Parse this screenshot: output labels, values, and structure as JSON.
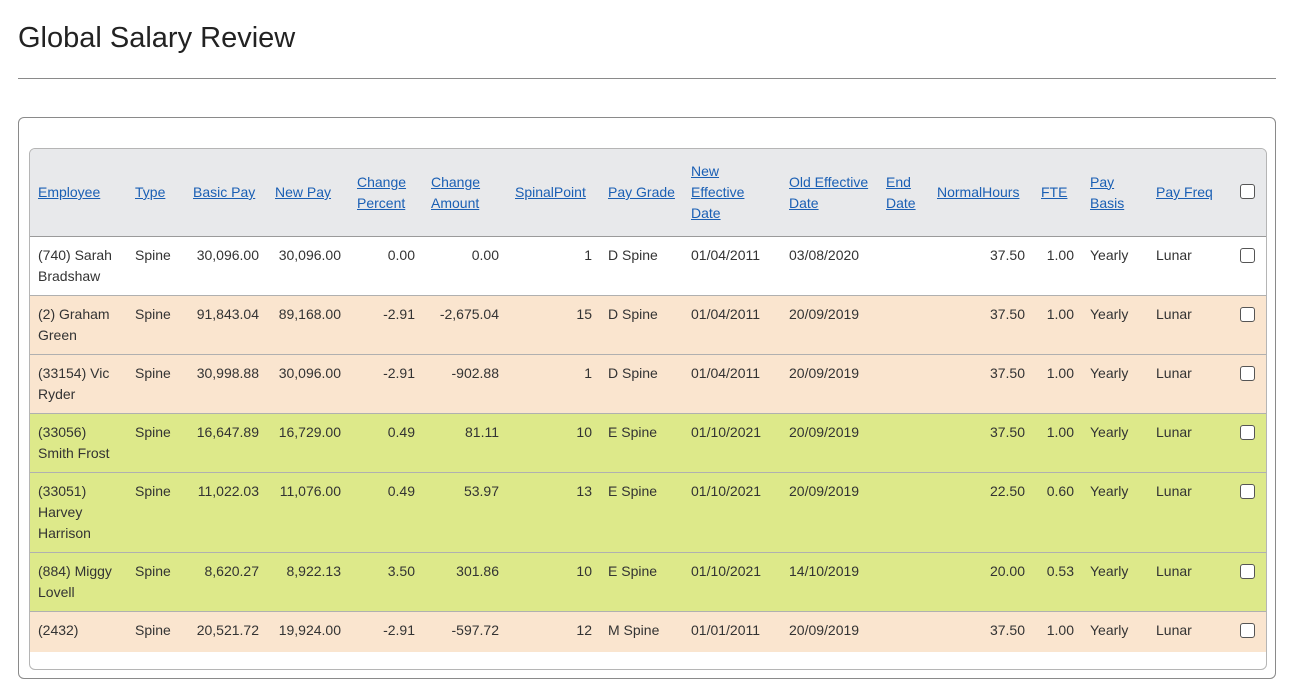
{
  "page": {
    "title": "Global Salary Review"
  },
  "table": {
    "columns": [
      {
        "key": "employee",
        "label": "Employee"
      },
      {
        "key": "type",
        "label": "Type"
      },
      {
        "key": "basic_pay",
        "label": "Basic Pay"
      },
      {
        "key": "new_pay",
        "label": "New Pay"
      },
      {
        "key": "change_percent",
        "label": "Change Percent"
      },
      {
        "key": "change_amount",
        "label": "Change Amount"
      },
      {
        "key": "spinal_point",
        "label": "SpinalPoint"
      },
      {
        "key": "pay_grade",
        "label": "Pay Grade"
      },
      {
        "key": "new_effective_date",
        "label": "New Effective Date"
      },
      {
        "key": "old_effective_date",
        "label": "Old Effective Date"
      },
      {
        "key": "end_date",
        "label": "End Date"
      },
      {
        "key": "normal_hours",
        "label": "NormalHours"
      },
      {
        "key": "fte",
        "label": "FTE"
      },
      {
        "key": "pay_basis",
        "label": "Pay Basis"
      },
      {
        "key": "pay_freq",
        "label": "Pay Freq"
      }
    ],
    "row_colors": {
      "white": "#ffffff",
      "peach": "#fae5cf",
      "lime": "#dde98a"
    },
    "rows": [
      {
        "color": "white",
        "employee": "(740) Sarah Bradshaw",
        "type": "Spine",
        "basic_pay": "30,096.00",
        "new_pay": "30,096.00",
        "change_percent": "0.00",
        "change_amount": "0.00",
        "spinal_point": "1",
        "pay_grade": "D Spine",
        "new_effective_date": "01/04/2011",
        "old_effective_date": "03/08/2020",
        "end_date": "",
        "normal_hours": "37.50",
        "fte": "1.00",
        "pay_basis": "Yearly",
        "pay_freq": "Lunar"
      },
      {
        "color": "peach",
        "employee": "(2) Graham Green",
        "type": "Spine",
        "basic_pay": "91,843.04",
        "new_pay": "89,168.00",
        "change_percent": "-2.91",
        "change_amount": "-2,675.04",
        "spinal_point": "15",
        "pay_grade": "D Spine",
        "new_effective_date": "01/04/2011",
        "old_effective_date": "20/09/2019",
        "end_date": "",
        "normal_hours": "37.50",
        "fte": "1.00",
        "pay_basis": "Yearly",
        "pay_freq": "Lunar"
      },
      {
        "color": "peach",
        "employee": "(33154) Vic Ryder",
        "type": "Spine",
        "basic_pay": "30,998.88",
        "new_pay": "30,096.00",
        "change_percent": "-2.91",
        "change_amount": "-902.88",
        "spinal_point": "1",
        "pay_grade": "D Spine",
        "new_effective_date": "01/04/2011",
        "old_effective_date": "20/09/2019",
        "end_date": "",
        "normal_hours": "37.50",
        "fte": "1.00",
        "pay_basis": "Yearly",
        "pay_freq": "Lunar"
      },
      {
        "color": "lime",
        "employee": "(33056) Smith Frost",
        "type": "Spine",
        "basic_pay": "16,647.89",
        "new_pay": "16,729.00",
        "change_percent": "0.49",
        "change_amount": "81.11",
        "spinal_point": "10",
        "pay_grade": "E Spine",
        "new_effective_date": "01/10/2021",
        "old_effective_date": "20/09/2019",
        "end_date": "",
        "normal_hours": "37.50",
        "fte": "1.00",
        "pay_basis": "Yearly",
        "pay_freq": "Lunar"
      },
      {
        "color": "lime",
        "employee": "(33051) Harvey Harrison",
        "type": "Spine",
        "basic_pay": "11,022.03",
        "new_pay": "11,076.00",
        "change_percent": "0.49",
        "change_amount": "53.97",
        "spinal_point": "13",
        "pay_grade": "E Spine",
        "new_effective_date": "01/10/2021",
        "old_effective_date": "20/09/2019",
        "end_date": "",
        "normal_hours": "22.50",
        "fte": "0.60",
        "pay_basis": "Yearly",
        "pay_freq": "Lunar"
      },
      {
        "color": "lime",
        "employee": "(884) Miggy Lovell",
        "type": "Spine",
        "basic_pay": "8,620.27",
        "new_pay": "8,922.13",
        "change_percent": "3.50",
        "change_amount": "301.86",
        "spinal_point": "10",
        "pay_grade": "E Spine",
        "new_effective_date": "01/10/2021",
        "old_effective_date": "14/10/2019",
        "end_date": "",
        "normal_hours": "20.00",
        "fte": "0.53",
        "pay_basis": "Yearly",
        "pay_freq": "Lunar"
      },
      {
        "color": "peach",
        "employee": "(2432)",
        "type": "Spine",
        "basic_pay": "20,521.72",
        "new_pay": "19,924.00",
        "change_percent": "-2.91",
        "change_amount": "-597.72",
        "spinal_point": "12",
        "pay_grade": "M Spine",
        "new_effective_date": "01/01/2011",
        "old_effective_date": "20/09/2019",
        "end_date": "",
        "normal_hours": "37.50",
        "fte": "1.00",
        "pay_basis": "Yearly",
        "pay_freq": "Lunar"
      }
    ]
  }
}
